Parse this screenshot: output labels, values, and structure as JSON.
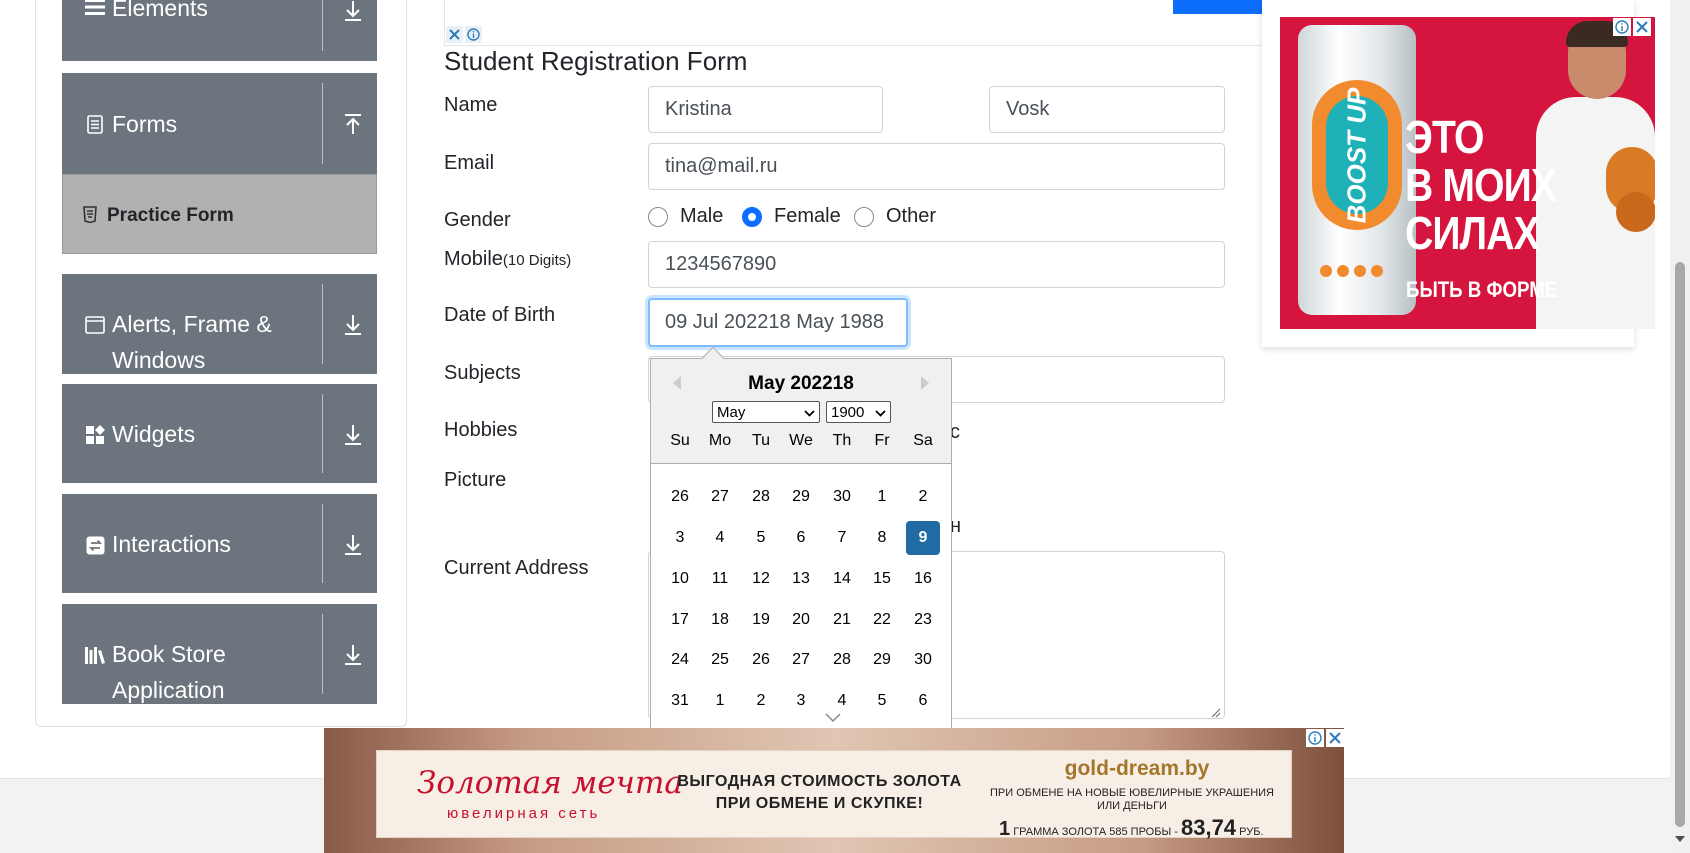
{
  "sidebar": {
    "groups": [
      {
        "label": "Elements",
        "icon": "list-icon",
        "arrow": "download-arrow-icon"
      },
      {
        "label": "Forms",
        "icon": "document-icon",
        "arrow": "upload-arrow-icon"
      },
      {
        "label": "Alerts, Frame & Windows",
        "icon": "window-icon",
        "arrow": "download-arrow-icon"
      },
      {
        "label": "Widgets",
        "icon": "widgets-icon",
        "arrow": "download-arrow-icon"
      },
      {
        "label": "Interactions",
        "icon": "interactions-icon",
        "arrow": "download-arrow-icon"
      },
      {
        "label": "Book Store Application",
        "icon": "books-icon",
        "arrow": "download-arrow-icon"
      }
    ],
    "active_item": "Practice Form"
  },
  "form": {
    "title": "Student Registration Form",
    "name_label": "Name",
    "first_name": "Kristina",
    "last_name": "Vosk",
    "email_label": "Email",
    "email": "tina@mail.ru",
    "gender_label": "Gender",
    "gender_options": [
      "Male",
      "Female",
      "Other"
    ],
    "gender_selected": "Female",
    "mobile_label": "Mobile",
    "mobile_hint": "(10 Digits)",
    "mobile": "1234567890",
    "dob_label": "Date of Birth",
    "dob_value": "09 Jul 202218 May 1988",
    "subjects_label": "Subjects",
    "hobbies_label": "Hobbies",
    "hobbies_peek": "c",
    "picture_label": "Picture",
    "picture_peek": "н",
    "address_label": "Current Address"
  },
  "datepicker": {
    "title": "May 202218",
    "month_select": "May",
    "year_select": "1900",
    "weekdays": [
      "Su",
      "Mo",
      "Tu",
      "We",
      "Th",
      "Fr",
      "Sa"
    ],
    "weeks": [
      [
        "26",
        "27",
        "28",
        "29",
        "30",
        "1",
        "2"
      ],
      [
        "3",
        "4",
        "5",
        "6",
        "7",
        "8",
        "9"
      ],
      [
        "10",
        "11",
        "12",
        "13",
        "14",
        "15",
        "16"
      ],
      [
        "17",
        "18",
        "19",
        "20",
        "21",
        "22",
        "23"
      ],
      [
        "24",
        "25",
        "26",
        "27",
        "28",
        "29",
        "30"
      ],
      [
        "31",
        "1",
        "2",
        "3",
        "4",
        "5",
        "6"
      ]
    ],
    "selected_day": "9",
    "selected_color": "#216ba5"
  },
  "right_ad": {
    "brand": "BOOST UP",
    "slogan": [
      "ЭТО",
      "В МОИХ",
      "СИЛАХ"
    ],
    "tagline": "БЫТЬ В ФОРМЕ",
    "background": "#d6153e"
  },
  "bottom_ad": {
    "logo": "Золотая мечта",
    "logo_sub": "ювелирная сеть",
    "headline_1": "ВЫГОДНАЯ СТОИМОСТЬ ЗОЛОТА",
    "headline_2": "ПРИ ОБМЕНЕ И СКУПКЕ!",
    "site": "gold-dream.by",
    "info": "ПРИ ОБМЕНЕ НА НОВЫЕ ЮВЕЛИРНЫЕ УКРАШЕНИЯ ИЛИ ДЕНЬГИ",
    "price_prefix": "1",
    "price_middle": "ГРАММА ЗОЛОТА 585 ПРОБЫ -",
    "price": "83,74",
    "price_suffix": "РУБ."
  },
  "colors": {
    "sidebar_group": "#6c757d",
    "active_item": "#b1b1b1",
    "accent": "#0d6efd"
  }
}
